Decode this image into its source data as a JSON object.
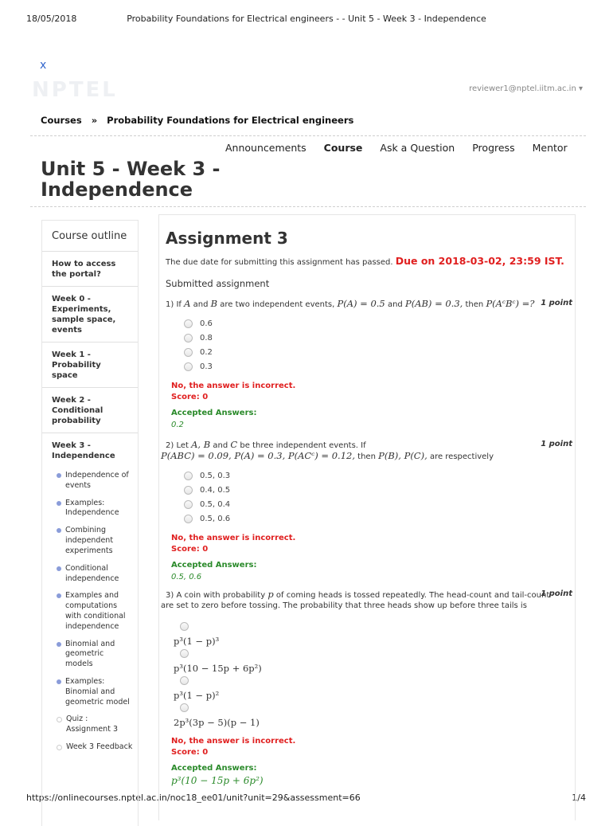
{
  "print_header": {
    "date": "18/05/2018",
    "title": "Probability Foundations for Electrical engineers - - Unit 5 - Week 3 - Independence"
  },
  "print_footer": {
    "url": "https://onlinecourses.nptel.ac.in/noc18_ee01/unit?unit=29&assessment=66",
    "page": "1/4"
  },
  "header": {
    "close_symbol": "x",
    "logo_text": "NPTEL",
    "user": "reviewer1@nptel.iitm.ac.in ▾"
  },
  "breadcrumb": {
    "root": "Courses",
    "separator": "»",
    "course": "Probability Foundations for Electrical engineers"
  },
  "nav": {
    "items": [
      "Announcements",
      "Course",
      "Ask a Question",
      "Progress",
      "Mentor"
    ],
    "active": "Course"
  },
  "page_title": "Unit 5 - Week 3 - Independence",
  "sidebar": {
    "heading": "Course outline",
    "weeks": [
      "How to access the portal?",
      "Week 0 - Experiments, sample space, events",
      "Week 1 - Probability space",
      "Week 2 - Conditional probability",
      "Week 3 - Independence"
    ],
    "units": [
      {
        "label": "Independence of events",
        "icon": "filled-dot-icon"
      },
      {
        "label": "Examples: Independence",
        "icon": "filled-dot-icon"
      },
      {
        "label": "Combining independent experiments",
        "icon": "filled-dot-icon"
      },
      {
        "label": "Conditional independence",
        "icon": "filled-dot-icon"
      },
      {
        "label": "Examples and computations with conditional independence",
        "icon": "filled-dot-icon"
      },
      {
        "label": "Binomial and geometric models",
        "icon": "filled-dot-icon"
      },
      {
        "label": "Examples: Binomial and geometric model",
        "icon": "filled-dot-icon"
      },
      {
        "label": "Quiz : Assignment 3",
        "icon": "hollow-dot-icon"
      },
      {
        "label": "Week 3 Feedback",
        "icon": "hollow-dot-icon"
      }
    ]
  },
  "assignment": {
    "title": "Assignment 3",
    "due_text": "The due date for submitting this assignment has passed.",
    "due_date": "Due on 2018-03-02, 23:59 IST.",
    "submitted_label": "Submitted assignment",
    "incorrect_text": "No, the answer is incorrect.",
    "score_text": "Score: 0",
    "accepted_label": "Accepted Answers:",
    "point_label": "1 point",
    "q1": {
      "number": "1)",
      "pre": "If",
      "a": "A",
      "and1": "and",
      "b": "B",
      "text_mid": "are two independent events,",
      "eq1": "P(A) = 0.5",
      "and2": "and",
      "eq2": "P(AB) = 0.3,",
      "then": "then",
      "eq3": "P(AᶜBᶜ) =?",
      "options": [
        "0.6",
        "0.8",
        "0.2",
        "0.3"
      ],
      "accepted": "0.2"
    },
    "q2": {
      "number": "2)",
      "pre": "Let",
      "vars": "A, B",
      "and": "and",
      "c": "C",
      "text_mid": "be three independent events. If",
      "eq_line": "P(ABC) = 0.09, P(A) = 0.3, P(ACᶜ) = 0.12,",
      "then": "then",
      "eq_res": "P(B), P(C),",
      "tail": "are respectively",
      "options": [
        "0.5, 0.3",
        "0.4, 0.5",
        "0.5, 0.4",
        "0.5, 0.6"
      ],
      "accepted": "0.5, 0.6"
    },
    "q3": {
      "number": "3)",
      "pre": "A coin with probability",
      "p": "p",
      "line1_rest": "of coming heads is tossed repeatedly. The head-count and tail-count",
      "line2": "are set to zero before tossing. The probability that three heads show up before three tails is",
      "options": [
        "p³(1 − p)³",
        "p³(10 − 15p + 6p²)",
        "p³(1 − p)²",
        "2p³(3p − 5)(p − 1)"
      ],
      "accepted": "p³(10 − 15p + 6p²)"
    }
  }
}
